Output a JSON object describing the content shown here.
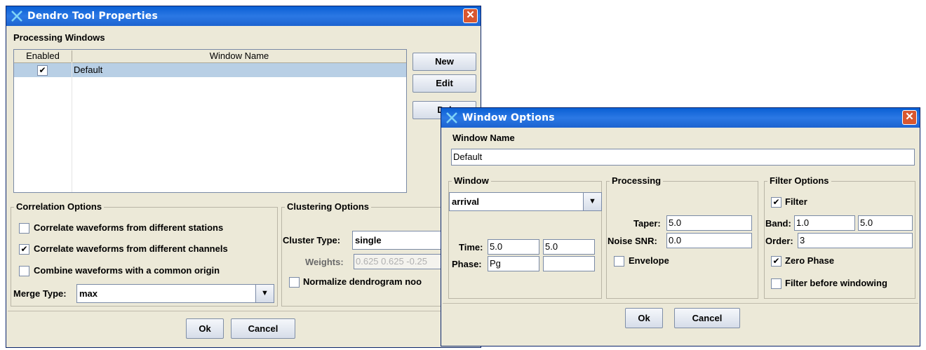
{
  "dendro": {
    "title": "Dendro Tool Properties",
    "processing_windows_label": "Processing Windows",
    "table": {
      "col_enabled": "Enabled",
      "col_name": "Window Name",
      "rows": [
        {
          "enabled": "✔",
          "name": "Default"
        }
      ]
    },
    "buttons": {
      "new": "New",
      "edit": "Edit",
      "delete": "Del",
      "ok": "Ok",
      "cancel": "Cancel"
    },
    "correlation": {
      "label": "Correlation Options",
      "opt1": "Correlate waveforms from different stations",
      "opt2": "Correlate waveforms from different channels",
      "opt3": "Combine waveforms with a common origin",
      "opt2_check": "✔",
      "merge_label": "Merge Type:",
      "merge_value": "max"
    },
    "clustering": {
      "label": "Clustering Options",
      "type_label": "Cluster Type:",
      "type_value": "single",
      "weights_label": "Weights:",
      "weights_value": "0.625 0.625 -0.25",
      "normalize_label": "Normalize dendrogram noo"
    }
  },
  "window_options": {
    "title": "Window Options",
    "name_label": "Window Name",
    "name_value": "Default",
    "window_group": {
      "label": "Window",
      "combo_value": "arrival",
      "time_label": "Time:",
      "time_start": "5.0",
      "time_end": "5.0",
      "phase_label": "Phase:",
      "phase_value": "Pg",
      "phase_extra": ""
    },
    "processing_group": {
      "label": "Processing",
      "taper_label": "Taper:",
      "taper_value": "5.0",
      "snr_label": "Noise SNR:",
      "snr_value": "0.0",
      "envelope_label": "Envelope"
    },
    "filter_group": {
      "label": "Filter Options",
      "filter_label": "Filter",
      "filter_check": "✔",
      "band_label": "Band:",
      "band_low": "1.0",
      "band_high": "5.0",
      "order_label": "Order:",
      "order_value": "3",
      "zero_phase_label": "Zero Phase",
      "zero_phase_check": "✔",
      "before_label": "Filter before windowing"
    },
    "ok": "Ok",
    "cancel": "Cancel"
  },
  "icons": {
    "arrow": "▼",
    "close": "✕"
  },
  "colors": {
    "titlebar": "#1d63d0",
    "close": "#d9572f",
    "selection": "#b8cfe5",
    "face": "#ece9d8"
  }
}
